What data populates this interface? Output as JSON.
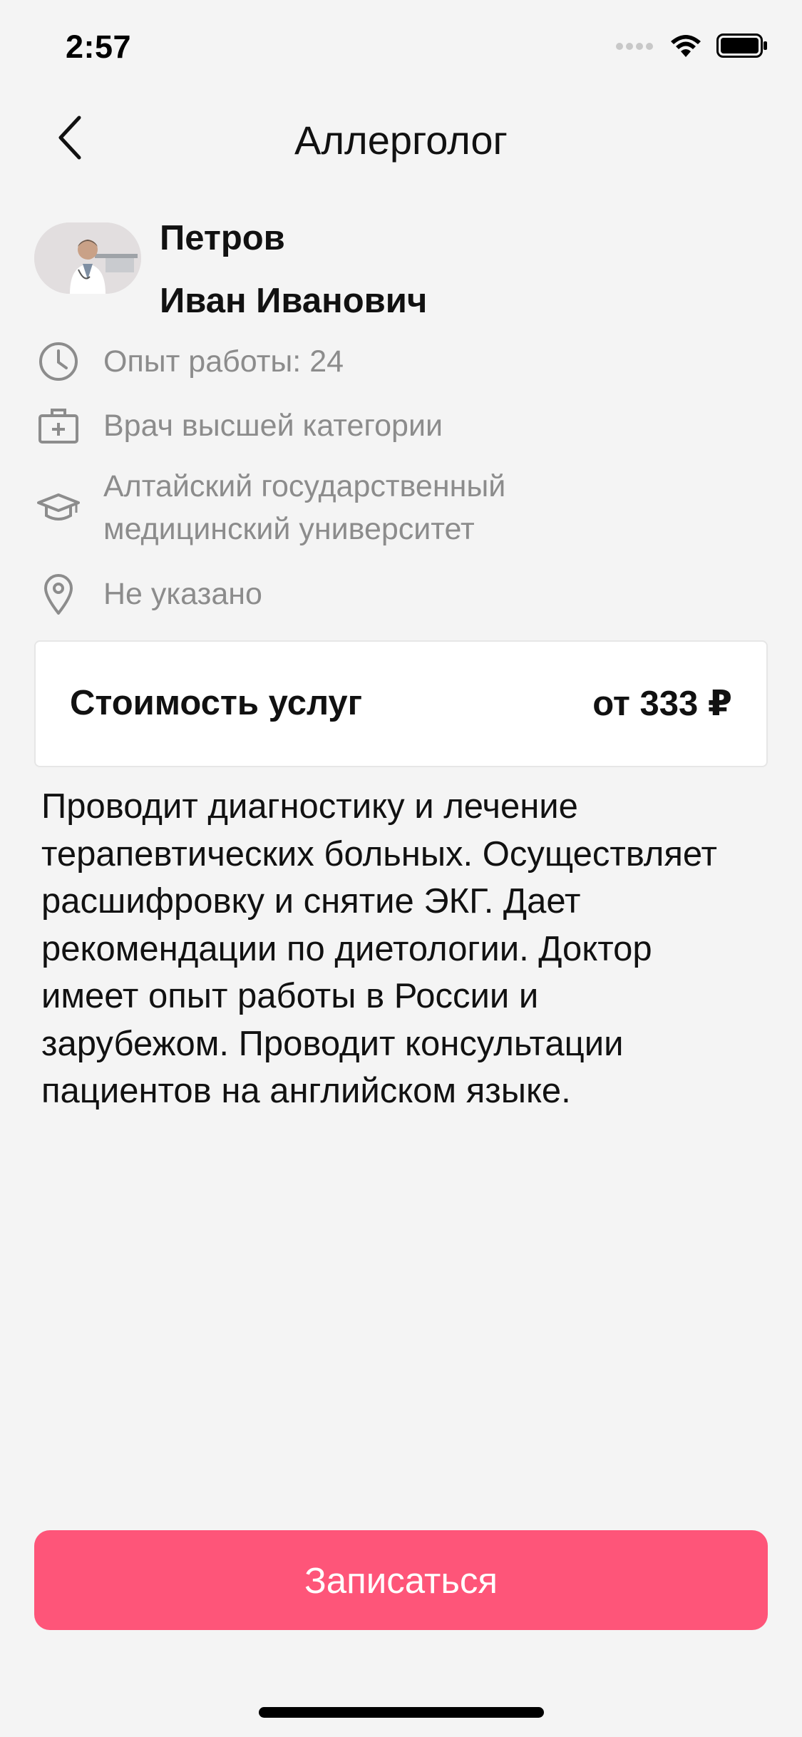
{
  "status_bar": {
    "time": "2:57"
  },
  "nav": {
    "title": "Аллерголог",
    "back_icon": "chevron-left-icon"
  },
  "doctor": {
    "last_name": "Петров",
    "first_and_patronymic": "Иван Иванович"
  },
  "info": {
    "experience": "Опыт работы: 24",
    "category": "Врач высшей категории",
    "education_line1": "Алтайский государственный",
    "education_line2": "медицинский университет",
    "location": "Не указано"
  },
  "price": {
    "label": "Стоимость услуг",
    "value": "от 333 ₽"
  },
  "description": {
    "lines": [
      "Проводит диагностику и лечение",
      "терапевтических больных. Осуществляет",
      "расшифровку и снятие ЭКГ. Дает",
      "рекомендации по диетологии. Доктор",
      "имеет опыт работы в России и",
      "зарубежом. Проводит консультации",
      "пациентов на английском языке."
    ]
  },
  "actions": {
    "book_label": "Записаться"
  },
  "colors": {
    "background": "#f4f4f4",
    "accent": "#fe5579",
    "muted_text": "#8c8c8c",
    "card": "#ffffff"
  }
}
